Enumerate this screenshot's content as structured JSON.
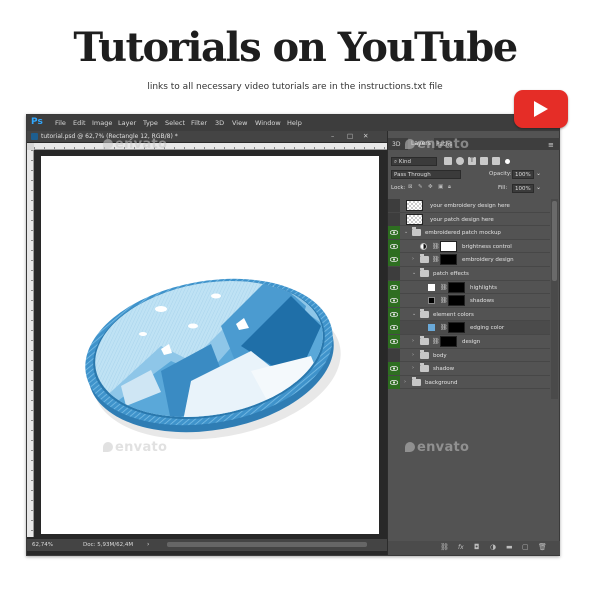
{
  "header": {
    "title": "Tutorials on YouTube",
    "subtitle": "links to all necessary video tutorials are in the instructions.txt file"
  },
  "youtube": {
    "icon": "youtube-play-icon",
    "color": "#e52d27"
  },
  "app": {
    "logo": "Ps",
    "menu": [
      "File",
      "Edit",
      "Image",
      "Layer",
      "Type",
      "Select",
      "Filter",
      "3D",
      "View",
      "Window",
      "Help"
    ],
    "window_controls": [
      "–",
      "□",
      "✕"
    ]
  },
  "document": {
    "tab_title": "tutorial.psd @ 62,7% (Rectangle 12, RGB/8) *",
    "tab_controls": [
      "–",
      "□",
      "✕"
    ],
    "status_zoom": "62,74%",
    "status_doc": "Doc: 5,93M/62,4M",
    "status_arrow": "›"
  },
  "panel": {
    "tabs": [
      "3D",
      "Layers",
      "Paths"
    ],
    "active_tab": "Layers",
    "kind_label": "Kind",
    "blend_mode": "Pass Through",
    "opacity_label": "Opacity:",
    "opacity_value": "100%",
    "lock_label": "Lock:",
    "fill_label": "Fill:",
    "fill_value": "100%",
    "layers": [
      {
        "name": "your embroidery design here",
        "visible": false
      },
      {
        "name": "your patch design here",
        "visible": false
      },
      {
        "name": "embroidered patch mockup",
        "visible": true
      },
      {
        "name": "brightness control",
        "visible": true
      },
      {
        "name": "embroidery design",
        "visible": true
      },
      {
        "name": "patch effects",
        "visible": false
      },
      {
        "name": "highlights",
        "visible": true
      },
      {
        "name": "shadows",
        "visible": true
      },
      {
        "name": "element colors",
        "visible": true
      },
      {
        "name": "edging color",
        "visible": true
      },
      {
        "name": "design",
        "visible": true
      },
      {
        "name": "body",
        "visible": false
      },
      {
        "name": "shadow",
        "visible": true
      },
      {
        "name": "background",
        "visible": true
      }
    ],
    "footer_icons": [
      "link-icon",
      "fx-icon",
      "mask-icon",
      "adjustment-icon",
      "group-icon",
      "new-layer-icon",
      "trash-icon"
    ]
  },
  "watermark": "envato",
  "colors": {
    "eye_active": "#2e6e21",
    "ps_blue": "#31a8ff",
    "patch_border": "#3b8fc8",
    "patch_fill": "#bde0f3"
  }
}
